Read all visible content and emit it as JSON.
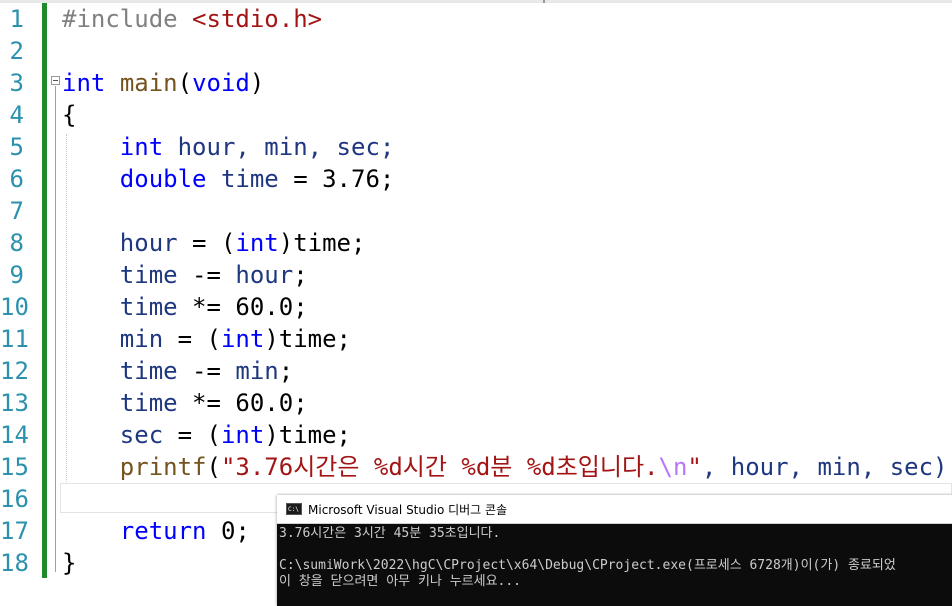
{
  "editor": {
    "line_numbers": [
      "1",
      "2",
      "3",
      "4",
      "5",
      "6",
      "7",
      "8",
      "9",
      "10",
      "11",
      "12",
      "13",
      "14",
      "15",
      "16",
      "17",
      "18"
    ],
    "tokens": {
      "l1_directive": "#include ",
      "l1_header": "<stdio.h>",
      "l3_int": "int",
      "l3_main": "main",
      "l3_paren_open": "(",
      "l3_void": "void",
      "l3_paren_close": ")",
      "l4_brace": "{",
      "l5_int": "int",
      "l5_decl": " hour, min, sec;",
      "l6_double": "double",
      "l6_time": " time",
      "l6_rest": " = 3.76;",
      "l8_hour": "hour",
      "l8_eq": " = (",
      "l8_int": "int",
      "l8_rest": ")time;",
      "l9_time": "time",
      "l9_op": " -= ",
      "l9_hour": "hour",
      "l9_semi": ";",
      "l10_time": "time",
      "l10_rest": " *= 60.0;",
      "l11_min": "min",
      "l11_eq": " = (",
      "l11_int": "int",
      "l11_rest": ")time;",
      "l12_time": "time",
      "l12_op": " -= ",
      "l12_min": "min",
      "l12_semi": ";",
      "l13_time": "time",
      "l13_rest": " *= 60.0;",
      "l14_sec": "sec",
      "l14_eq": " = (",
      "l14_int": "int",
      "l14_rest": ")time;",
      "l15_printf": "printf",
      "l15_open": "(",
      "l15_str": "\"3.76시간은 %d시간 %d분 %d초입니다.",
      "l15_esc": "\\n",
      "l15_quote": "\"",
      "l15_args": ", hour, min, sec);",
      "l17_return": "return",
      "l17_rest": " 0;",
      "l18_brace": "}"
    }
  },
  "console": {
    "icon_text": "C:\\",
    "title": "Microsoft Visual Studio 디버그 콘솔",
    "lines": [
      "3.76시간은 3시간 45분 35초입니다.",
      "",
      "C:\\sumiWork\\2022\\hgC\\CProject\\x64\\Debug\\CProject.exe(프로세스 6728개)이(가) 종료되었",
      "이 창을 닫으려면 아무 키나 누르세요..."
    ]
  },
  "colors": {
    "keyword": "#0000ff",
    "string": "#a31515",
    "escape": "#b776fb",
    "function": "#74531f",
    "variable": "#1f377f",
    "line_number": "#2b91af",
    "change_bar": "#1e8a2c",
    "console_bg": "#0c0c0c"
  }
}
